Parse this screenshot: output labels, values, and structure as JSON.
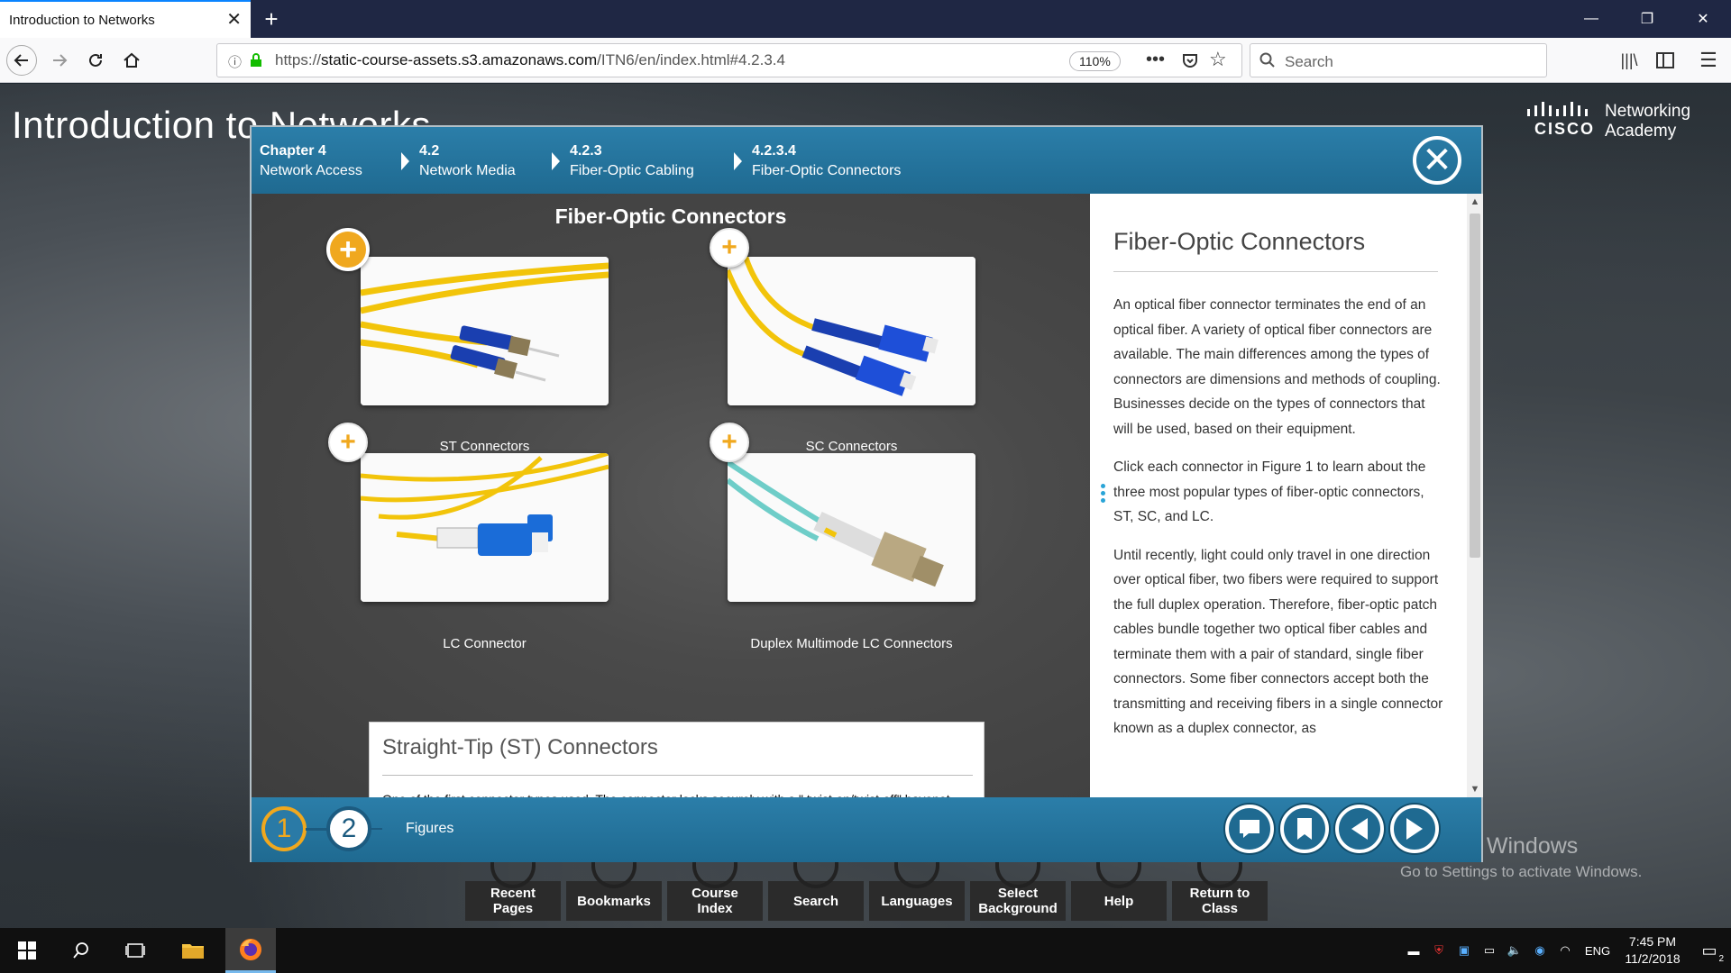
{
  "browser": {
    "tab_title": "Introduction to Networks",
    "url_prefix": "https://",
    "url_host": "static-course-assets.s3.amazonaws.com",
    "url_path": "/ITN6/en/index.html#4.2.3.4",
    "zoom": "110%",
    "search_placeholder": "Search"
  },
  "course": {
    "title": "Introduction to Networks",
    "logo_word": "CISCO",
    "academy_line1": "Networking",
    "academy_line2": "Academy"
  },
  "breadcrumb": [
    {
      "num": "Chapter 4",
      "label": "Network Access"
    },
    {
      "num": "4.2",
      "label": "Network Media"
    },
    {
      "num": "4.2.3",
      "label": "Fiber-Optic Cabling"
    },
    {
      "num": "4.2.3.4",
      "label": "Fiber-Optic Connectors"
    }
  ],
  "figure": {
    "title": "Fiber-Optic Connectors",
    "items": [
      {
        "label": "ST Connectors"
      },
      {
        "label": "SC Connectors"
      },
      {
        "label": "LC Connector"
      },
      {
        "label": "Duplex Multimode LC Connectors"
      }
    ],
    "detail_title": "Straight-Tip (ST) Connectors",
    "detail_text": "One of the first connector types used. The connector locks securely with a \" twist-on/twist-off\" bayonet style mechanism."
  },
  "text": {
    "heading": "Fiber-Optic Connectors",
    "p1": "An optical fiber connector terminates the end of an optical fiber. A variety of optical fiber connectors are available. The main differences among the types of connectors are dimensions and methods of coupling. Businesses decide on the types of connectors that will be used, based on their equipment.",
    "p2": "Click each connector in Figure 1 to learn about the three most popular types of fiber-optic connectors, ST, SC, and LC.",
    "p3": "Until recently, light could only travel in one direction over optical fiber, two fibers were required to support the full duplex operation. Therefore, fiber-optic patch cables bundle together two optical fiber cables and terminate them with a pair of standard, single fiber connectors. Some fiber connectors accept both the transmitting and receiving fibers in a single connector known as a duplex connector, as"
  },
  "footer": {
    "fig1": "1",
    "fig2": "2",
    "figures_label": "Figures"
  },
  "menu": [
    {
      "label": "Recent Pages"
    },
    {
      "label": "Bookmarks"
    },
    {
      "label": "Course Index"
    },
    {
      "label": "Search"
    },
    {
      "label": "Languages"
    },
    {
      "label": "Select Background"
    },
    {
      "label": "Help"
    },
    {
      "label": "Return to Class"
    }
  ],
  "watermark": {
    "line1": "Activate Windows",
    "line2": "Go to Settings to activate Windows."
  },
  "taskbar": {
    "lang": "ENG",
    "time": "7:45 PM",
    "date": "11/2/2018",
    "notif_count": "2"
  },
  "colors": {
    "accent": "#1f6a91",
    "plus": "#f0a81e"
  }
}
